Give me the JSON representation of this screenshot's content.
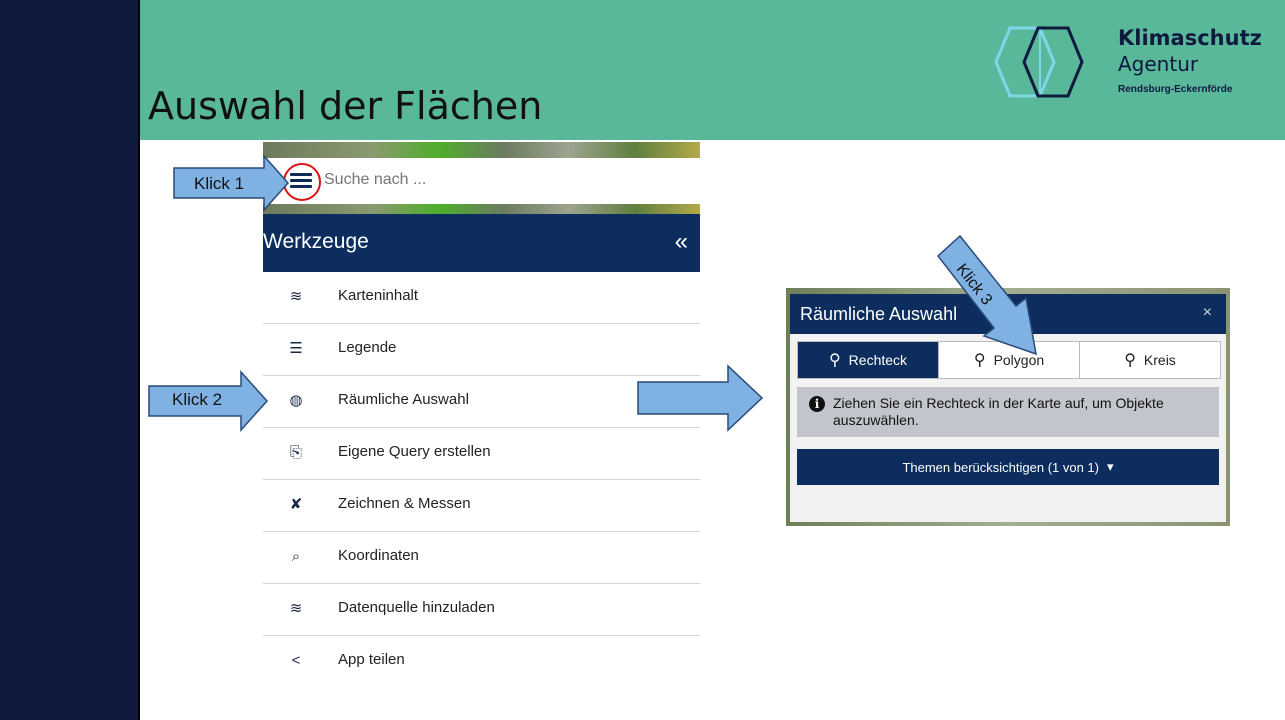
{
  "slide": {
    "title": "Auswahl der Flächen"
  },
  "logo": {
    "line1": "Klimaschutz",
    "line2": "Agentur",
    "line3": "Rendsburg-Eckernförde"
  },
  "search": {
    "placeholder": "Suche nach ..."
  },
  "toolbar": {
    "title": "Werkzeuge",
    "collapse": "«"
  },
  "menu": {
    "items": [
      {
        "label": "Karteninhalt",
        "icon": "layers-icon"
      },
      {
        "label": "Legende",
        "icon": "list-icon"
      },
      {
        "label": "Räumliche Auswahl",
        "icon": "spatial-select-icon"
      },
      {
        "label": "Eigene Query erstellen",
        "icon": "query-icon"
      },
      {
        "label": "Zeichnen & Messen",
        "icon": "draw-measure-icon"
      },
      {
        "label": "Koordinaten",
        "icon": "coordinates-icon"
      },
      {
        "label": "Datenquelle hinzuladen",
        "icon": "add-datasource-icon"
      },
      {
        "label": "App teilen",
        "icon": "share-icon"
      }
    ]
  },
  "annotations": {
    "klick1": "Klick 1",
    "klick2": "Klick 2",
    "klick3": "Klick 3"
  },
  "panel": {
    "title": "Räumliche Auswahl",
    "close": "×",
    "tabs": [
      {
        "label": "Rechteck",
        "active": true
      },
      {
        "label": "Polygon",
        "active": false
      },
      {
        "label": "Kreis",
        "active": false
      }
    ],
    "info": "Ziehen Sie ein Rechteck in der Karte auf, um Objekte auszuwählen.",
    "themen_button": "Themen berücksichtigen (1 von 1)"
  },
  "colors": {
    "header_green": "#5ab89a",
    "navy": "#0c2d5e",
    "left_band": "#0f1a3e",
    "arrow_fill": "#7fb2e3"
  }
}
